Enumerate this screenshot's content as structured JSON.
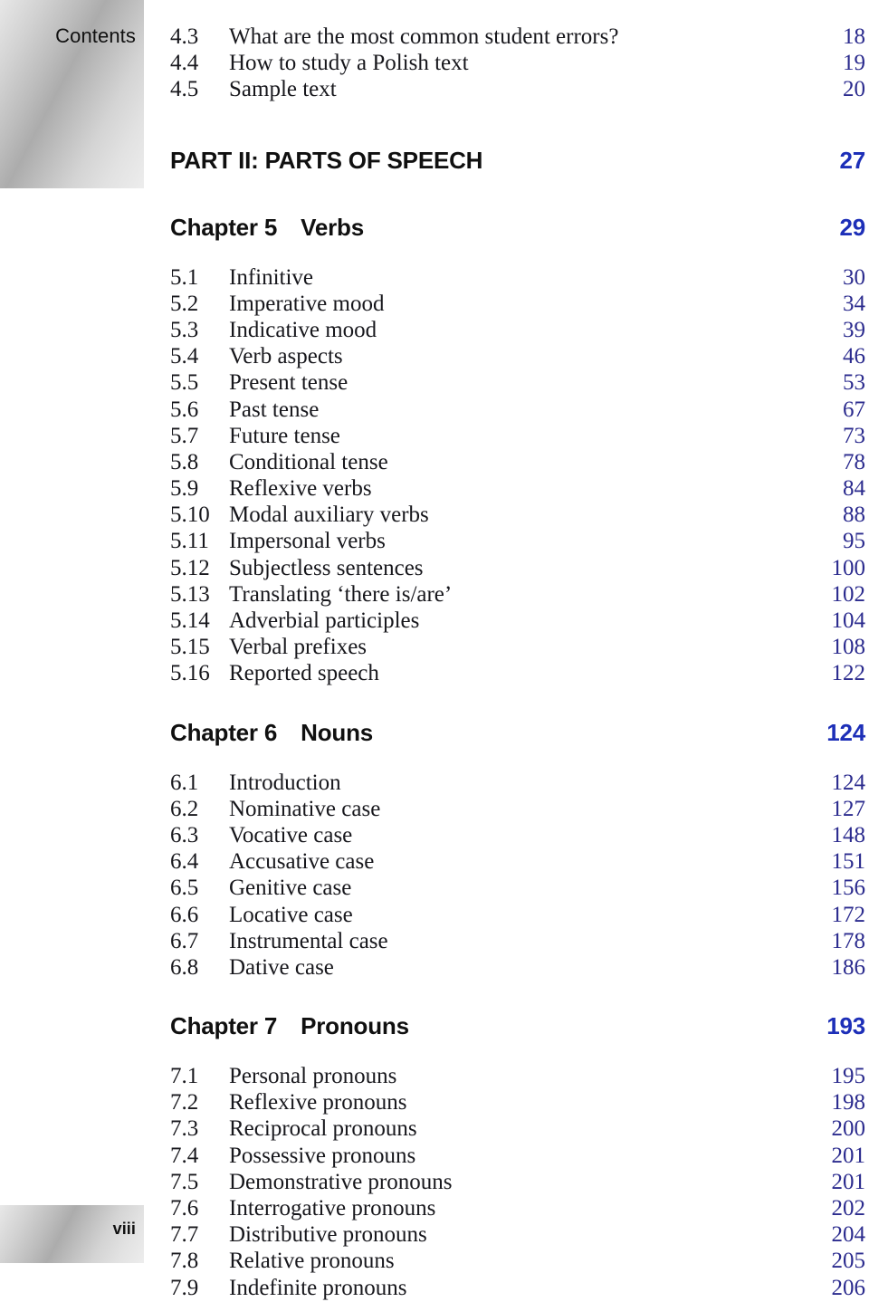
{
  "tab": {
    "contents_label": "Contents",
    "folio": "viii"
  },
  "colors": {
    "body_text": "#17171c",
    "entry_page_number": "#2b2b8e",
    "heading_page_number": "#1d2fb8",
    "tab_gradient_light": "#ededed",
    "tab_gradient_dark": "#acacac"
  },
  "entries": {
    "e0": {
      "num": "4.3",
      "title": "What are the most common student errors?",
      "page": "18"
    },
    "e1": {
      "num": "4.4",
      "title": "How to study a Polish text",
      "page": "19"
    },
    "e2": {
      "num": "4.5",
      "title": "Sample text",
      "page": "20"
    },
    "part2": {
      "title": "PART II: PARTS OF SPEECH",
      "page": "27"
    },
    "ch5": {
      "num": "Chapter 5",
      "title": "Verbs",
      "page": "29"
    },
    "e3": {
      "num": "5.1",
      "title": "Infinitive",
      "page": "30"
    },
    "e4": {
      "num": "5.2",
      "title": "Imperative mood",
      "page": "34"
    },
    "e5": {
      "num": "5.3",
      "title": "Indicative mood",
      "page": "39"
    },
    "e6": {
      "num": "5.4",
      "title": "Verb aspects",
      "page": "46"
    },
    "e7": {
      "num": "5.5",
      "title": "Present tense",
      "page": "53"
    },
    "e8": {
      "num": "5.6",
      "title": "Past tense",
      "page": "67"
    },
    "e9": {
      "num": "5.7",
      "title": "Future tense",
      "page": "73"
    },
    "e10": {
      "num": "5.8",
      "title": "Conditional tense",
      "page": "78"
    },
    "e11": {
      "num": "5.9",
      "title": "Reflexive verbs",
      "page": "84"
    },
    "e12": {
      "num": "5.10",
      "title": "Modal auxiliary verbs",
      "page": "88"
    },
    "e13": {
      "num": "5.11",
      "title": "Impersonal verbs",
      "page": "95"
    },
    "e14": {
      "num": "5.12",
      "title": "Subjectless sentences",
      "page": "100"
    },
    "e15": {
      "num": "5.13",
      "title": "Translating ‘there is/are’",
      "page": "102"
    },
    "e16": {
      "num": "5.14",
      "title": "Adverbial participles",
      "page": "104"
    },
    "e17": {
      "num": "5.15",
      "title": "Verbal prefixes",
      "page": "108"
    },
    "e18": {
      "num": "5.16",
      "title": "Reported speech",
      "page": "122"
    },
    "ch6": {
      "num": "Chapter 6",
      "title": "Nouns",
      "page": "124"
    },
    "e19": {
      "num": "6.1",
      "title": "Introduction",
      "page": "124"
    },
    "e20": {
      "num": "6.2",
      "title": "Nominative case",
      "page": "127"
    },
    "e21": {
      "num": "6.3",
      "title": "Vocative case",
      "page": "148"
    },
    "e22": {
      "num": "6.4",
      "title": "Accusative case",
      "page": "151"
    },
    "e23": {
      "num": "6.5",
      "title": "Genitive case",
      "page": "156"
    },
    "e24": {
      "num": "6.6",
      "title": "Locative case",
      "page": "172"
    },
    "e25": {
      "num": "6.7",
      "title": "Instrumental case",
      "page": "178"
    },
    "e26": {
      "num": "6.8",
      "title": "Dative case",
      "page": "186"
    },
    "ch7": {
      "num": "Chapter 7",
      "title": "Pronouns",
      "page": "193"
    },
    "e27": {
      "num": "7.1",
      "title": "Personal pronouns",
      "page": "195"
    },
    "e28": {
      "num": "7.2",
      "title": "Reflexive pronouns",
      "page": "198"
    },
    "e29": {
      "num": "7.3",
      "title": "Reciprocal pronouns",
      "page": "200"
    },
    "e30": {
      "num": "7.4",
      "title": "Possessive pronouns",
      "page": "201"
    },
    "e31": {
      "num": "7.5",
      "title": "Demonstrative pronouns",
      "page": "201"
    },
    "e32": {
      "num": "7.6",
      "title": "Interrogative pronouns",
      "page": "202"
    },
    "e33": {
      "num": "7.7",
      "title": "Distributive pronouns",
      "page": "204"
    },
    "e34": {
      "num": "7.8",
      "title": "Relative pronouns",
      "page": "205"
    },
    "e35": {
      "num": "7.9",
      "title": "Indefinite pronouns",
      "page": "206"
    }
  }
}
